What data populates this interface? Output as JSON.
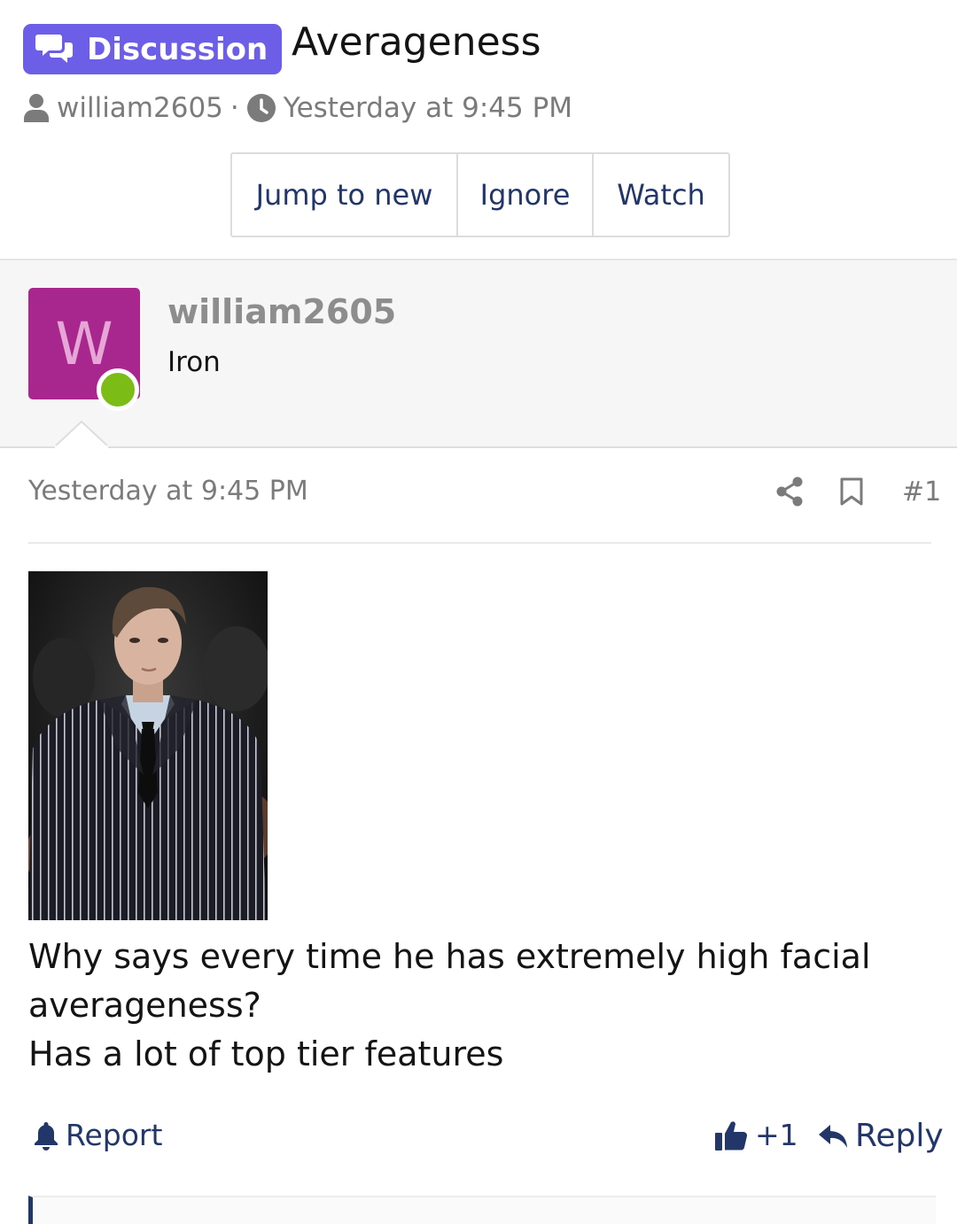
{
  "thread": {
    "prefix": "Discussion",
    "title": "Averageness",
    "author": "william2605",
    "separator": "·",
    "timestamp": "Yesterday at 9:45 PM"
  },
  "actions": {
    "jump_to_new": "Jump to new",
    "ignore": "Ignore",
    "watch": "Watch"
  },
  "post": {
    "avatar_letter": "W",
    "username": "william2605",
    "user_title": "Iron",
    "date": "Yesterday at 9:45 PM",
    "number": "#1",
    "lines": [
      "Why says every time he has extremely high facial",
      "averageness?",
      "Has a lot of top tier features"
    ],
    "report_label": "Report",
    "reaction_count": "+1",
    "reply_label": "Reply"
  },
  "colors": {
    "prefix_bg": "#6d5ee8",
    "link": "#22366a",
    "avatar_bg": "#a7278e",
    "online": "#7bbd16",
    "muted": "#7b7b7b"
  },
  "icons": [
    "chat-bubbles-icon",
    "user-icon",
    "clock-icon",
    "share-icon",
    "bookmark-icon",
    "bell-icon",
    "thumbs-up-icon",
    "reply-arrow-icon"
  ]
}
